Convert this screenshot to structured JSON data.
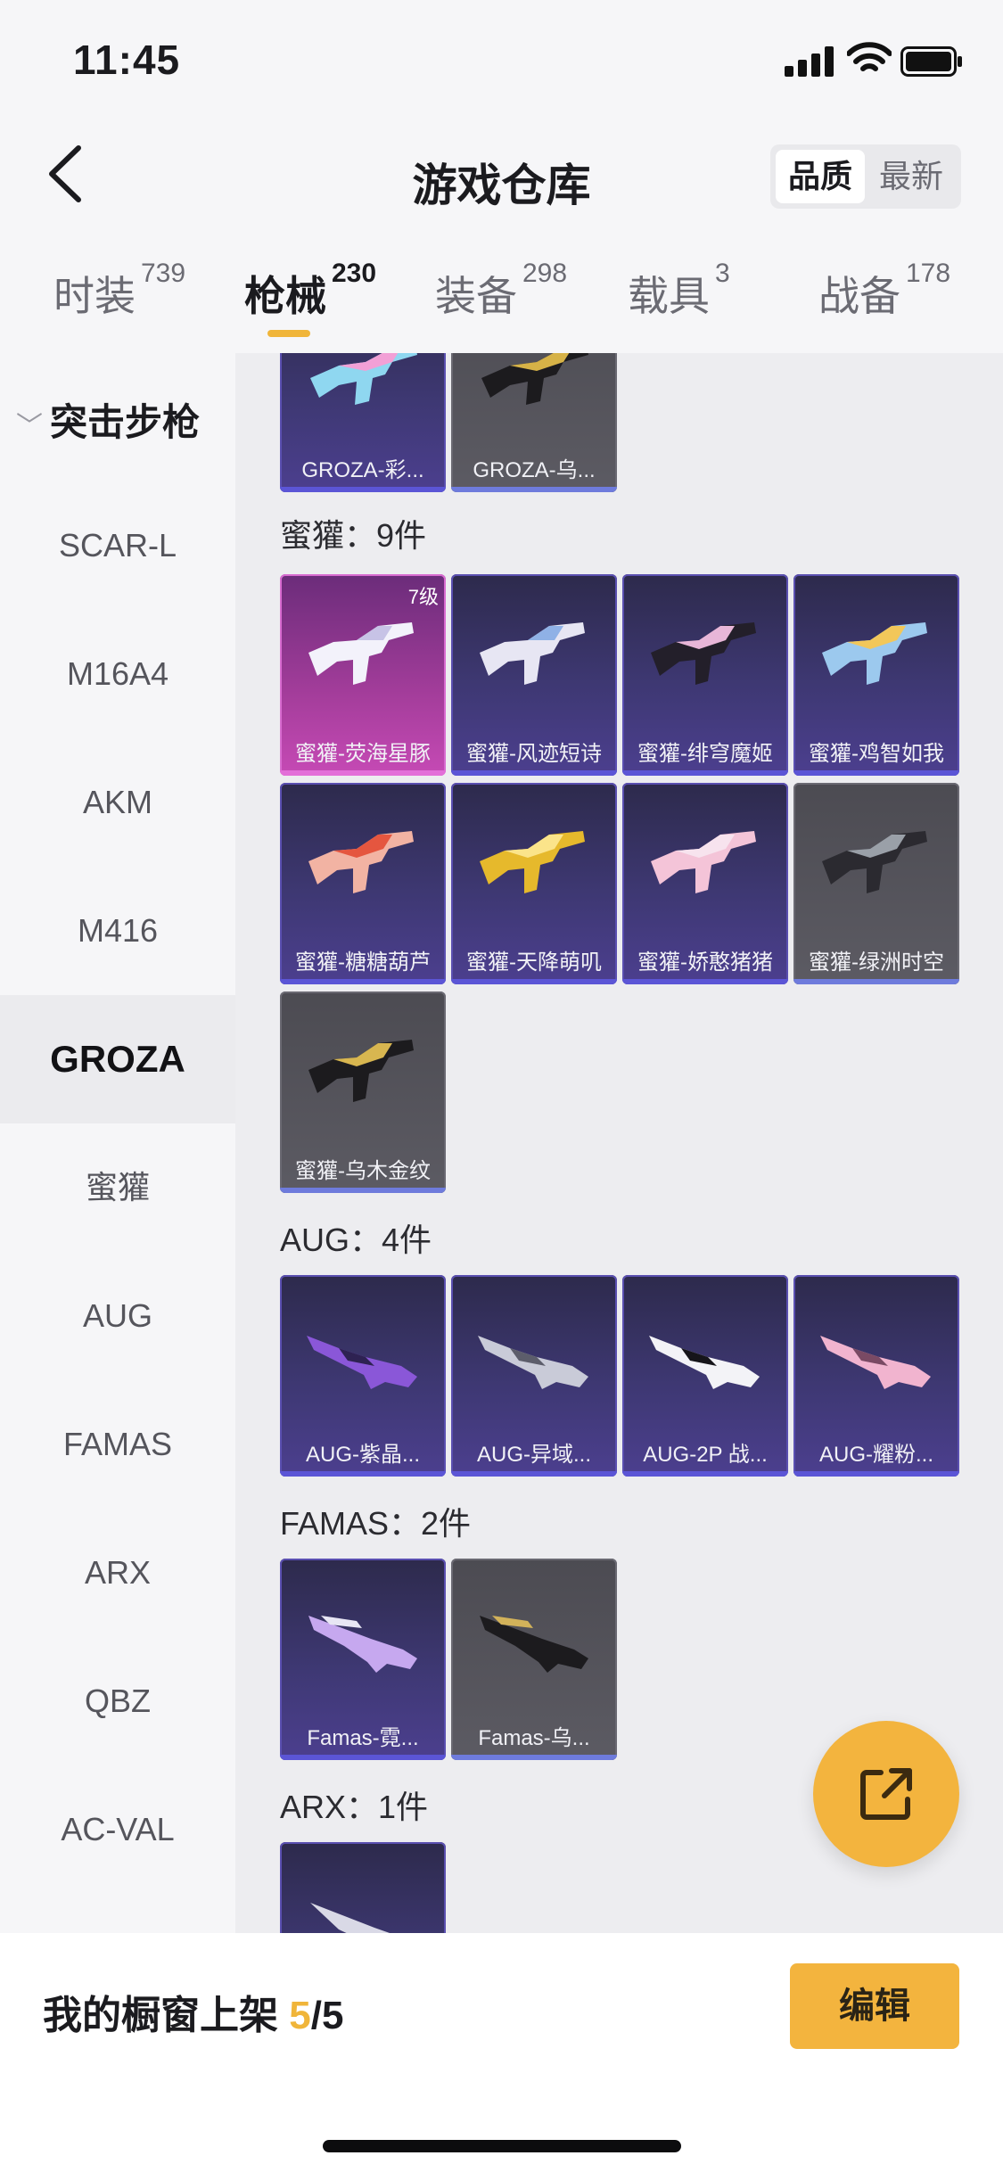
{
  "status": {
    "time": "11:45"
  },
  "header": {
    "title": "游戏仓库",
    "sort": [
      "品质",
      "最新"
    ]
  },
  "tabs": [
    {
      "label": "时装",
      "count": "739"
    },
    {
      "label": "枪械",
      "count": "230"
    },
    {
      "label": "装备",
      "count": "298"
    },
    {
      "label": "载具",
      "count": "3"
    },
    {
      "label": "战备",
      "count": "178"
    }
  ],
  "sidebar": {
    "group": "突击步枪",
    "items": [
      "SCAR-L",
      "M16A4",
      "AKM",
      "M416",
      "GROZA",
      "蜜獾",
      "AUG",
      "FAMAS",
      "ARX",
      "QBZ",
      "AC-VAL"
    ],
    "active": "GROZA"
  },
  "sections": {
    "top_cards": [
      "GROZA-彩...",
      "GROZA-乌..."
    ],
    "honey": {
      "title": "蜜獾：9件",
      "cards": [
        "蜜獾-荧海星豚",
        "蜜獾-风迹短诗",
        "蜜獾-绯穹魔姬",
        "蜜獾-鸡智如我",
        "蜜獾-糖糖葫芦",
        "蜜獾-天降萌叽",
        "蜜獾-娇憨猪猪",
        "蜜獾-绿洲时空",
        "蜜獾-乌木金纹"
      ],
      "level_badge": "7级"
    },
    "aug": {
      "title": "AUG：4件",
      "cards": [
        "AUG-紫晶...",
        "AUG-异域...",
        "AUG-2P 战...",
        "AUG-耀粉..."
      ]
    },
    "famas": {
      "title": "FAMAS：2件",
      "cards": [
        "Famas-霓...",
        "Famas-乌..."
      ]
    },
    "arx": {
      "title": "ARX：1件"
    }
  },
  "bottom": {
    "shelf_label": "我的橱窗上架",
    "shelf_current": "5",
    "shelf_total": "/5",
    "edit": "编辑"
  }
}
